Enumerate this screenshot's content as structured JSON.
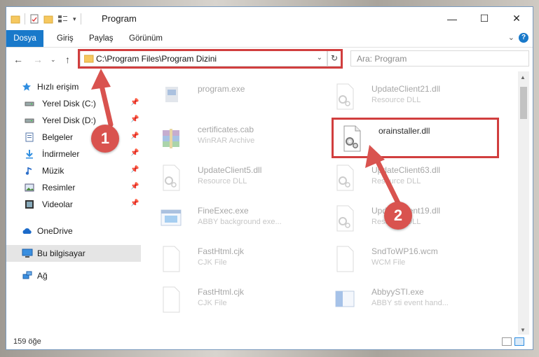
{
  "window": {
    "title": "Program"
  },
  "ribbon": {
    "tabs": [
      "Dosya",
      "Giriş",
      "Paylaş",
      "Görünüm"
    ]
  },
  "address": {
    "path": "C:\\Program Files\\Program Dizini"
  },
  "search": {
    "placeholder": "Ara: Program"
  },
  "sidebar": {
    "items": [
      {
        "label": "Hızlı erişim",
        "icon": "star-icon"
      },
      {
        "label": "Yerel Disk (C:)",
        "icon": "drive-icon",
        "pinned": true
      },
      {
        "label": "Yerel Disk (D:)",
        "icon": "drive-icon",
        "pinned": true
      },
      {
        "label": "Belgeler",
        "icon": "documents-icon",
        "pinned": true
      },
      {
        "label": "İndirmeler",
        "icon": "download-icon",
        "pinned": true
      },
      {
        "label": "Müzik",
        "icon": "music-icon",
        "pinned": true
      },
      {
        "label": "Resimler",
        "icon": "pictures-icon",
        "pinned": true
      },
      {
        "label": "Videolar",
        "icon": "video-icon",
        "pinned": true
      },
      {
        "label": "OneDrive",
        "icon": "cloud-icon"
      },
      {
        "label": "Bu bilgisayar",
        "icon": "computer-icon",
        "selected": true
      },
      {
        "label": "Ağ",
        "icon": "network-icon"
      }
    ]
  },
  "files": [
    {
      "name": "program.exe",
      "type": ""
    },
    {
      "name": "UpdateClient21.dll",
      "type": "Resource DLL"
    },
    {
      "name": "certificates.cab",
      "type": "WinRAR Archive"
    },
    {
      "name": "orainstaller.dll",
      "type": ""
    },
    {
      "name": "UpdateClient5.dll",
      "type": "Resource DLL"
    },
    {
      "name": "UpdateClient63.dll",
      "type": "Resource DLL"
    },
    {
      "name": "FineExec.exe",
      "type": "ABBY background exe..."
    },
    {
      "name": "UpdateClient19.dll",
      "type": "Resource DLL"
    },
    {
      "name": "FastHtml.cjk",
      "type": "CJK File"
    },
    {
      "name": "SndToWP16.wcm",
      "type": "WCM File"
    },
    {
      "name": "FastHtml.cjk",
      "type": "CJK File"
    },
    {
      "name": "AbbyySTI.exe",
      "type": "ABBY sti event hand..."
    }
  ],
  "status": {
    "count": "159 öğe"
  },
  "annotations": {
    "badge1": "1",
    "badge2": "2"
  },
  "colors": {
    "accent": "#1979ca",
    "highlight": "#d13e3e"
  }
}
